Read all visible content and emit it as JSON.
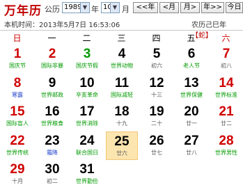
{
  "header": {
    "title": "万年历",
    "label_gregorian": "公历",
    "year": "1989",
    "label_year": "年",
    "month": "10",
    "label_month": "月",
    "btn_prev_year": "<<年",
    "btn_prev_month": "<月",
    "btn_next_month": "月>",
    "btn_next_year": "年>>",
    "btn_today": "今日"
  },
  "info": {
    "local_time": "本机时间：2013年5月7日 16:53:06",
    "lunar_prefix": "农历己巳年",
    "zodiac": "【蛇】"
  },
  "weekdays": [
    "日",
    "一",
    "二",
    "三",
    "四",
    "五",
    "六"
  ],
  "colors": {
    "sunday": "#d00000",
    "saturday": "#d00000",
    "weekday": "#000000",
    "holiday_text": "#009a00",
    "today_bg": "#fde5b0"
  },
  "days": [
    {
      "day": "1",
      "sub": "国庆节",
      "col": 0,
      "row": 0,
      "num_color": "red",
      "sub_color": "green"
    },
    {
      "day": "2",
      "sub": "国际非暴",
      "col": 1,
      "row": 0,
      "num_color": "red",
      "sub_color": "green"
    },
    {
      "day": "3",
      "sub": "国庆节假",
      "col": 2,
      "row": 0,
      "num_color": "green",
      "sub_color": "green"
    },
    {
      "day": "4",
      "sub": "世界动物",
      "col": 3,
      "row": 0,
      "num_color": "black",
      "sub_color": "green"
    },
    {
      "day": "5",
      "sub": "初六",
      "col": 4,
      "row": 0,
      "num_color": "black",
      "sub_color": "gray"
    },
    {
      "day": "6",
      "sub": "老人节",
      "col": 5,
      "row": 0,
      "num_color": "black",
      "sub_color": "green"
    },
    {
      "day": "7",
      "sub": "初八",
      "col": 6,
      "row": 0,
      "num_color": "red",
      "sub_color": "gray"
    },
    {
      "day": "8",
      "sub": "寒露",
      "col": 0,
      "row": 1,
      "num_color": "red",
      "sub_color": "blue"
    },
    {
      "day": "9",
      "sub": "世界邮政",
      "col": 1,
      "row": 1,
      "num_color": "black",
      "sub_color": "green"
    },
    {
      "day": "10",
      "sub": "辛亥革命",
      "col": 2,
      "row": 1,
      "num_color": "black",
      "sub_color": "green"
    },
    {
      "day": "11",
      "sub": "国际减轻",
      "col": 3,
      "row": 1,
      "num_color": "black",
      "sub_color": "green"
    },
    {
      "day": "12",
      "sub": "十三",
      "col": 4,
      "row": 1,
      "num_color": "black",
      "sub_color": "gray"
    },
    {
      "day": "13",
      "sub": "世界保健",
      "col": 5,
      "row": 1,
      "num_color": "black",
      "sub_color": "green"
    },
    {
      "day": "14",
      "sub": "世界标准",
      "col": 6,
      "row": 1,
      "num_color": "red",
      "sub_color": "green"
    },
    {
      "day": "15",
      "sub": "国际盲人",
      "col": 0,
      "row": 2,
      "num_color": "red",
      "sub_color": "green"
    },
    {
      "day": "16",
      "sub": "世界粮食",
      "col": 1,
      "row": 2,
      "num_color": "black",
      "sub_color": "green"
    },
    {
      "day": "17",
      "sub": "世界消除",
      "col": 2,
      "row": 2,
      "num_color": "black",
      "sub_color": "green"
    },
    {
      "day": "18",
      "sub": "十九",
      "col": 3,
      "row": 2,
      "num_color": "black",
      "sub_color": "gray"
    },
    {
      "day": "19",
      "sub": "二十",
      "col": 4,
      "row": 2,
      "num_color": "black",
      "sub_color": "gray"
    },
    {
      "day": "20",
      "sub": "廿一",
      "col": 5,
      "row": 2,
      "num_color": "black",
      "sub_color": "gray"
    },
    {
      "day": "21",
      "sub": "廿二",
      "col": 6,
      "row": 2,
      "num_color": "red",
      "sub_color": "gray"
    },
    {
      "day": "22",
      "sub": "世界传统",
      "col": 0,
      "row": 3,
      "num_color": "red",
      "sub_color": "green"
    },
    {
      "day": "23",
      "sub": "霜降",
      "col": 1,
      "row": 3,
      "num_color": "black",
      "sub_color": "blue"
    },
    {
      "day": "24",
      "sub": "联合国日",
      "col": 2,
      "row": 3,
      "num_color": "black",
      "sub_color": "green"
    },
    {
      "day": "25",
      "sub": "廿六",
      "col": 3,
      "row": 3,
      "num_color": "black",
      "sub_color": "gray",
      "today": true
    },
    {
      "day": "26",
      "sub": "廿七",
      "col": 4,
      "row": 3,
      "num_color": "black",
      "sub_color": "gray"
    },
    {
      "day": "27",
      "sub": "廿八",
      "col": 5,
      "row": 3,
      "num_color": "black",
      "sub_color": "gray"
    },
    {
      "day": "28",
      "sub": "世界男性",
      "col": 6,
      "row": 3,
      "num_color": "red",
      "sub_color": "green"
    },
    {
      "day": "29",
      "sub": "十月",
      "col": 0,
      "row": 4,
      "num_color": "red",
      "sub_color": "gray"
    },
    {
      "day": "30",
      "sub": "初二",
      "col": 1,
      "row": 4,
      "num_color": "black",
      "sub_color": "gray"
    },
    {
      "day": "31",
      "sub": "世界勤俭",
      "col": 2,
      "row": 4,
      "num_color": "black",
      "sub_color": "green"
    }
  ]
}
